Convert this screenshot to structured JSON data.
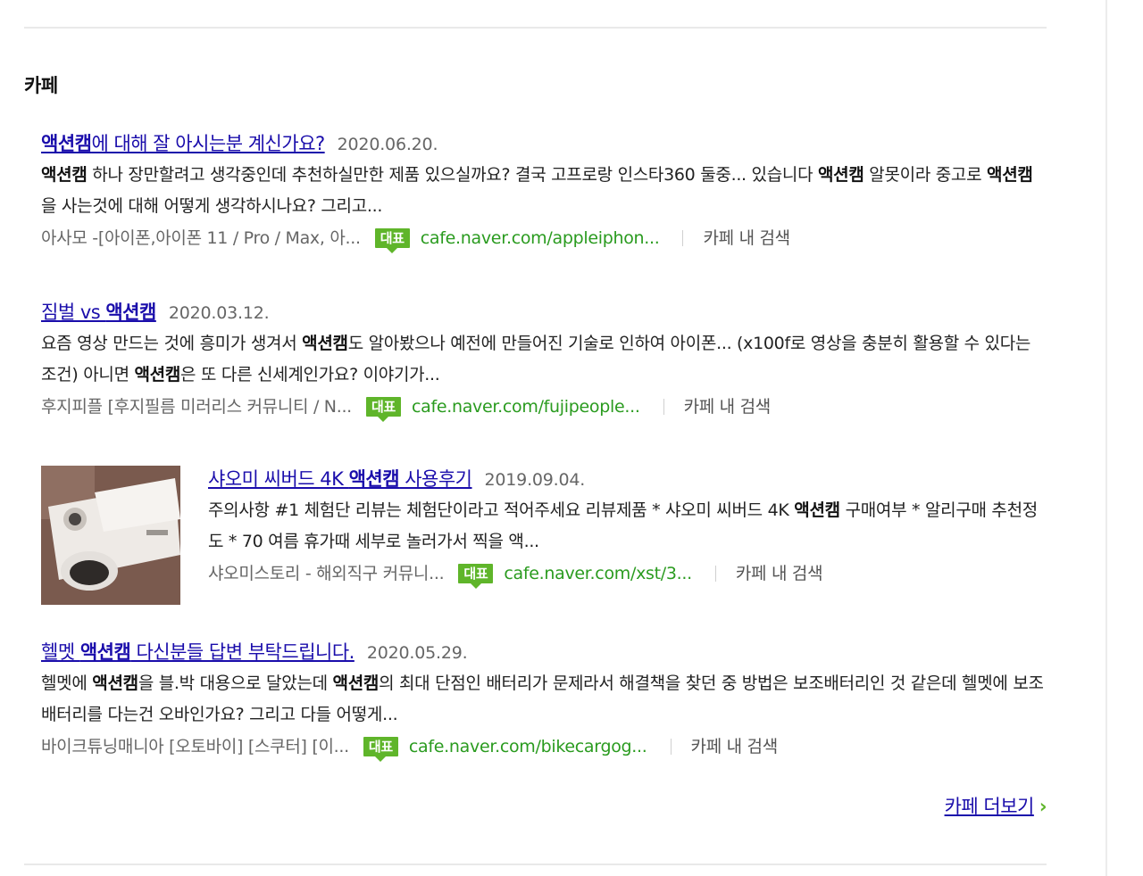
{
  "section": {
    "title": "카페"
  },
  "items": [
    {
      "title_parts": [
        {
          "text": "액션캠",
          "bold": true
        },
        {
          "text": "에 대해 잘 아시는분 계신가요?",
          "bold": false
        }
      ],
      "date": "2020.06.20.",
      "desc_parts": [
        {
          "text": "액션캠",
          "bold": true
        },
        {
          "text": " 하나 장만할려고 생각중인데 추천하실만한 제품 있으실까요? 결국 고프로랑 인스타360 둘중... 있습니다 ",
          "bold": false
        },
        {
          "text": "액션캠",
          "bold": true
        },
        {
          "text": " 알못이라 중고로 ",
          "bold": false
        },
        {
          "text": "액션캠",
          "bold": true
        },
        {
          "text": "을 사는것에 대해 어떻게 생각하시나요? 그리고...",
          "bold": false
        }
      ],
      "source": "아사모 -[아이폰,아이폰 11 / Pro / Max, 아...",
      "badge": "대표",
      "url": "cafe.naver.com/appleiphon...",
      "cafe_search": "카페 내 검색"
    },
    {
      "title_parts": [
        {
          "text": "짐벌 vs ",
          "bold": false
        },
        {
          "text": "액션캠",
          "bold": true
        }
      ],
      "date": "2020.03.12.",
      "desc_parts": [
        {
          "text": "요즘 영상 만드는 것에 흥미가 생겨서 ",
          "bold": false
        },
        {
          "text": "액션캠",
          "bold": true
        },
        {
          "text": "도 알아봤으나 예전에 만들어진 기술로 인하여 아이폰... (x100f로 영상을 충분히 활용할 수 있다는 조건) 아니면 ",
          "bold": false
        },
        {
          "text": "액션캠",
          "bold": true
        },
        {
          "text": "은 또 다른 신세계인가요? 이야기가...",
          "bold": false
        }
      ],
      "source": "후지피플 [후지필름 미러리스 커뮤니티 / N...",
      "badge": "대표",
      "url": "cafe.naver.com/fujipeople...",
      "cafe_search": "카페 내 검색"
    },
    {
      "has_thumbnail": true,
      "title_parts": [
        {
          "text": "샤오미 씨버드 4K ",
          "bold": false
        },
        {
          "text": "액션캠",
          "bold": true
        },
        {
          "text": " 사용후기",
          "bold": false
        }
      ],
      "date": "2019.09.04.",
      "desc_parts": [
        {
          "text": "주의사항 #1 체험단 리뷰는 체험단이라고 적어주세요 리뷰제품 *  샤오미 씨버드 4K ",
          "bold": false
        },
        {
          "text": "액션캠",
          "bold": true
        },
        {
          "text": " 구매여부 *  알리구매 추천정도 *  70 여름 휴가때 세부로 놀러가서 찍을 액...",
          "bold": false
        }
      ],
      "source": "샤오미스토리 - 해외직구 커뮤니...",
      "badge": "대표",
      "url": "cafe.naver.com/xst/3...",
      "cafe_search": "카페 내 검색"
    },
    {
      "title_parts": [
        {
          "text": "헬멧 ",
          "bold": false
        },
        {
          "text": "액션캠",
          "bold": true
        },
        {
          "text": " 다신분들 답변 부탁드립니다.",
          "bold": false
        }
      ],
      "date": "2020.05.29.",
      "desc_parts": [
        {
          "text": "헬멧에 ",
          "bold": false
        },
        {
          "text": "액션캠",
          "bold": true
        },
        {
          "text": "을 블.박 대용으로 달았는데 ",
          "bold": false
        },
        {
          "text": "액션캠",
          "bold": true
        },
        {
          "text": "의 최대 단점인 배터리가 문제라서 해결책을 찾던 중 방법은 보조배터리인 것 같은데 헬멧에 보조배터리를 다는건 오바인가요? 그리고 다들 어떻게...",
          "bold": false
        }
      ],
      "source": "바이크튜닝매니아 [오토바이] [스쿠터] [이...",
      "badge": "대표",
      "url": "cafe.naver.com/bikecargog...",
      "cafe_search": "카페 내 검색"
    }
  ],
  "more_link": {
    "label": "카페 더보기",
    "chevron": "›"
  },
  "colors": {
    "link": "#1a0dab",
    "url_green": "#2a9b1f",
    "badge_green": "#5fb52a"
  }
}
